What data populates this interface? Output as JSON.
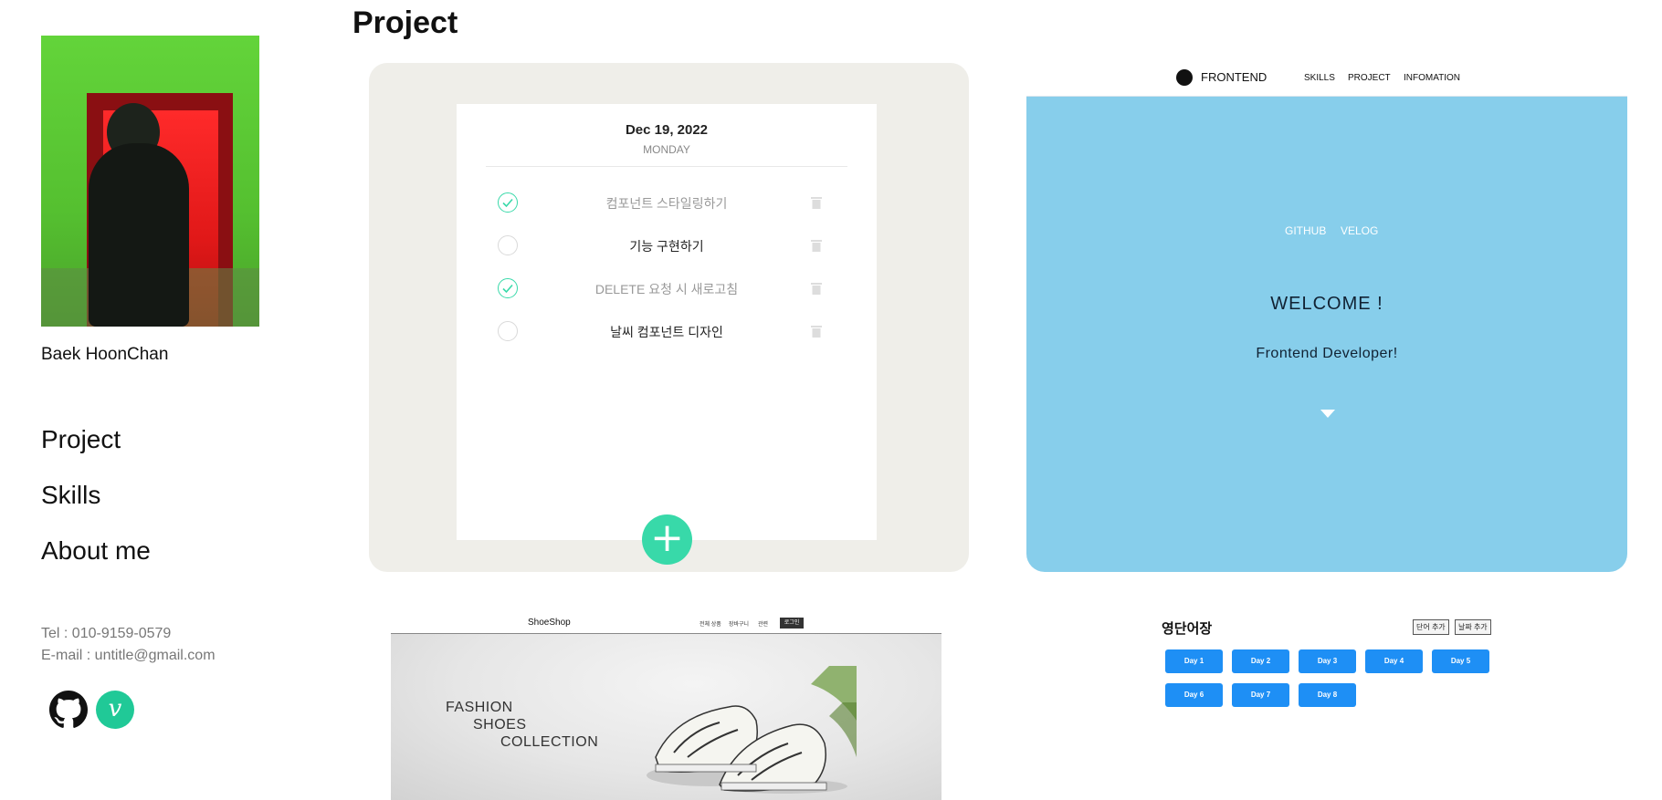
{
  "page": {
    "section_title": "Project"
  },
  "sidebar": {
    "name": "Baek HoonChan",
    "nav": [
      "Project",
      "Skills",
      "About me"
    ],
    "tel": "Tel : 010-9159-0579",
    "email": "E-mail : untitle@gmail.com",
    "social": [
      {
        "icon": "github-icon",
        "color": "#111111"
      },
      {
        "icon": "velog-icon",
        "label": "v",
        "color": "#20c997"
      }
    ]
  },
  "todo_card": {
    "date": "Dec 19, 2022",
    "day": "MONDAY",
    "items": [
      {
        "text": "컴포넌트 스타일링하기",
        "done": true
      },
      {
        "text": "기능 구현하기",
        "done": false
      },
      {
        "text": "DELETE 요청 시 새로고침",
        "done": true
      },
      {
        "text": "날씨 컴포넌트 디자인",
        "done": false
      }
    ],
    "add_label": "+",
    "accent": "#38d9a9"
  },
  "frontend_card": {
    "brand": "FRONTEND",
    "nav": [
      "SKILLS",
      "PROJECT",
      "INFOMATION"
    ],
    "links": [
      "GITHUB",
      "VELOG"
    ],
    "welcome": "WELCOME !",
    "subtitle": "Frontend Developer!",
    "bg_color": "#87ceeb"
  },
  "shoe_card": {
    "brand": "ShoeShop",
    "nav": [
      "전체 상품",
      "장바구니",
      "관련"
    ],
    "login": "로그인",
    "hero_lines": [
      "FASHION",
      "SHOES",
      "COLLECTION"
    ]
  },
  "word_card": {
    "title": "영단어장",
    "buttons": [
      "단어 추가",
      "날짜 추가"
    ],
    "days": [
      "Day 1",
      "Day 2",
      "Day 3",
      "Day 4",
      "Day 5",
      "Day 6",
      "Day 7",
      "Day 8"
    ],
    "button_color": "#1e8ff5"
  }
}
